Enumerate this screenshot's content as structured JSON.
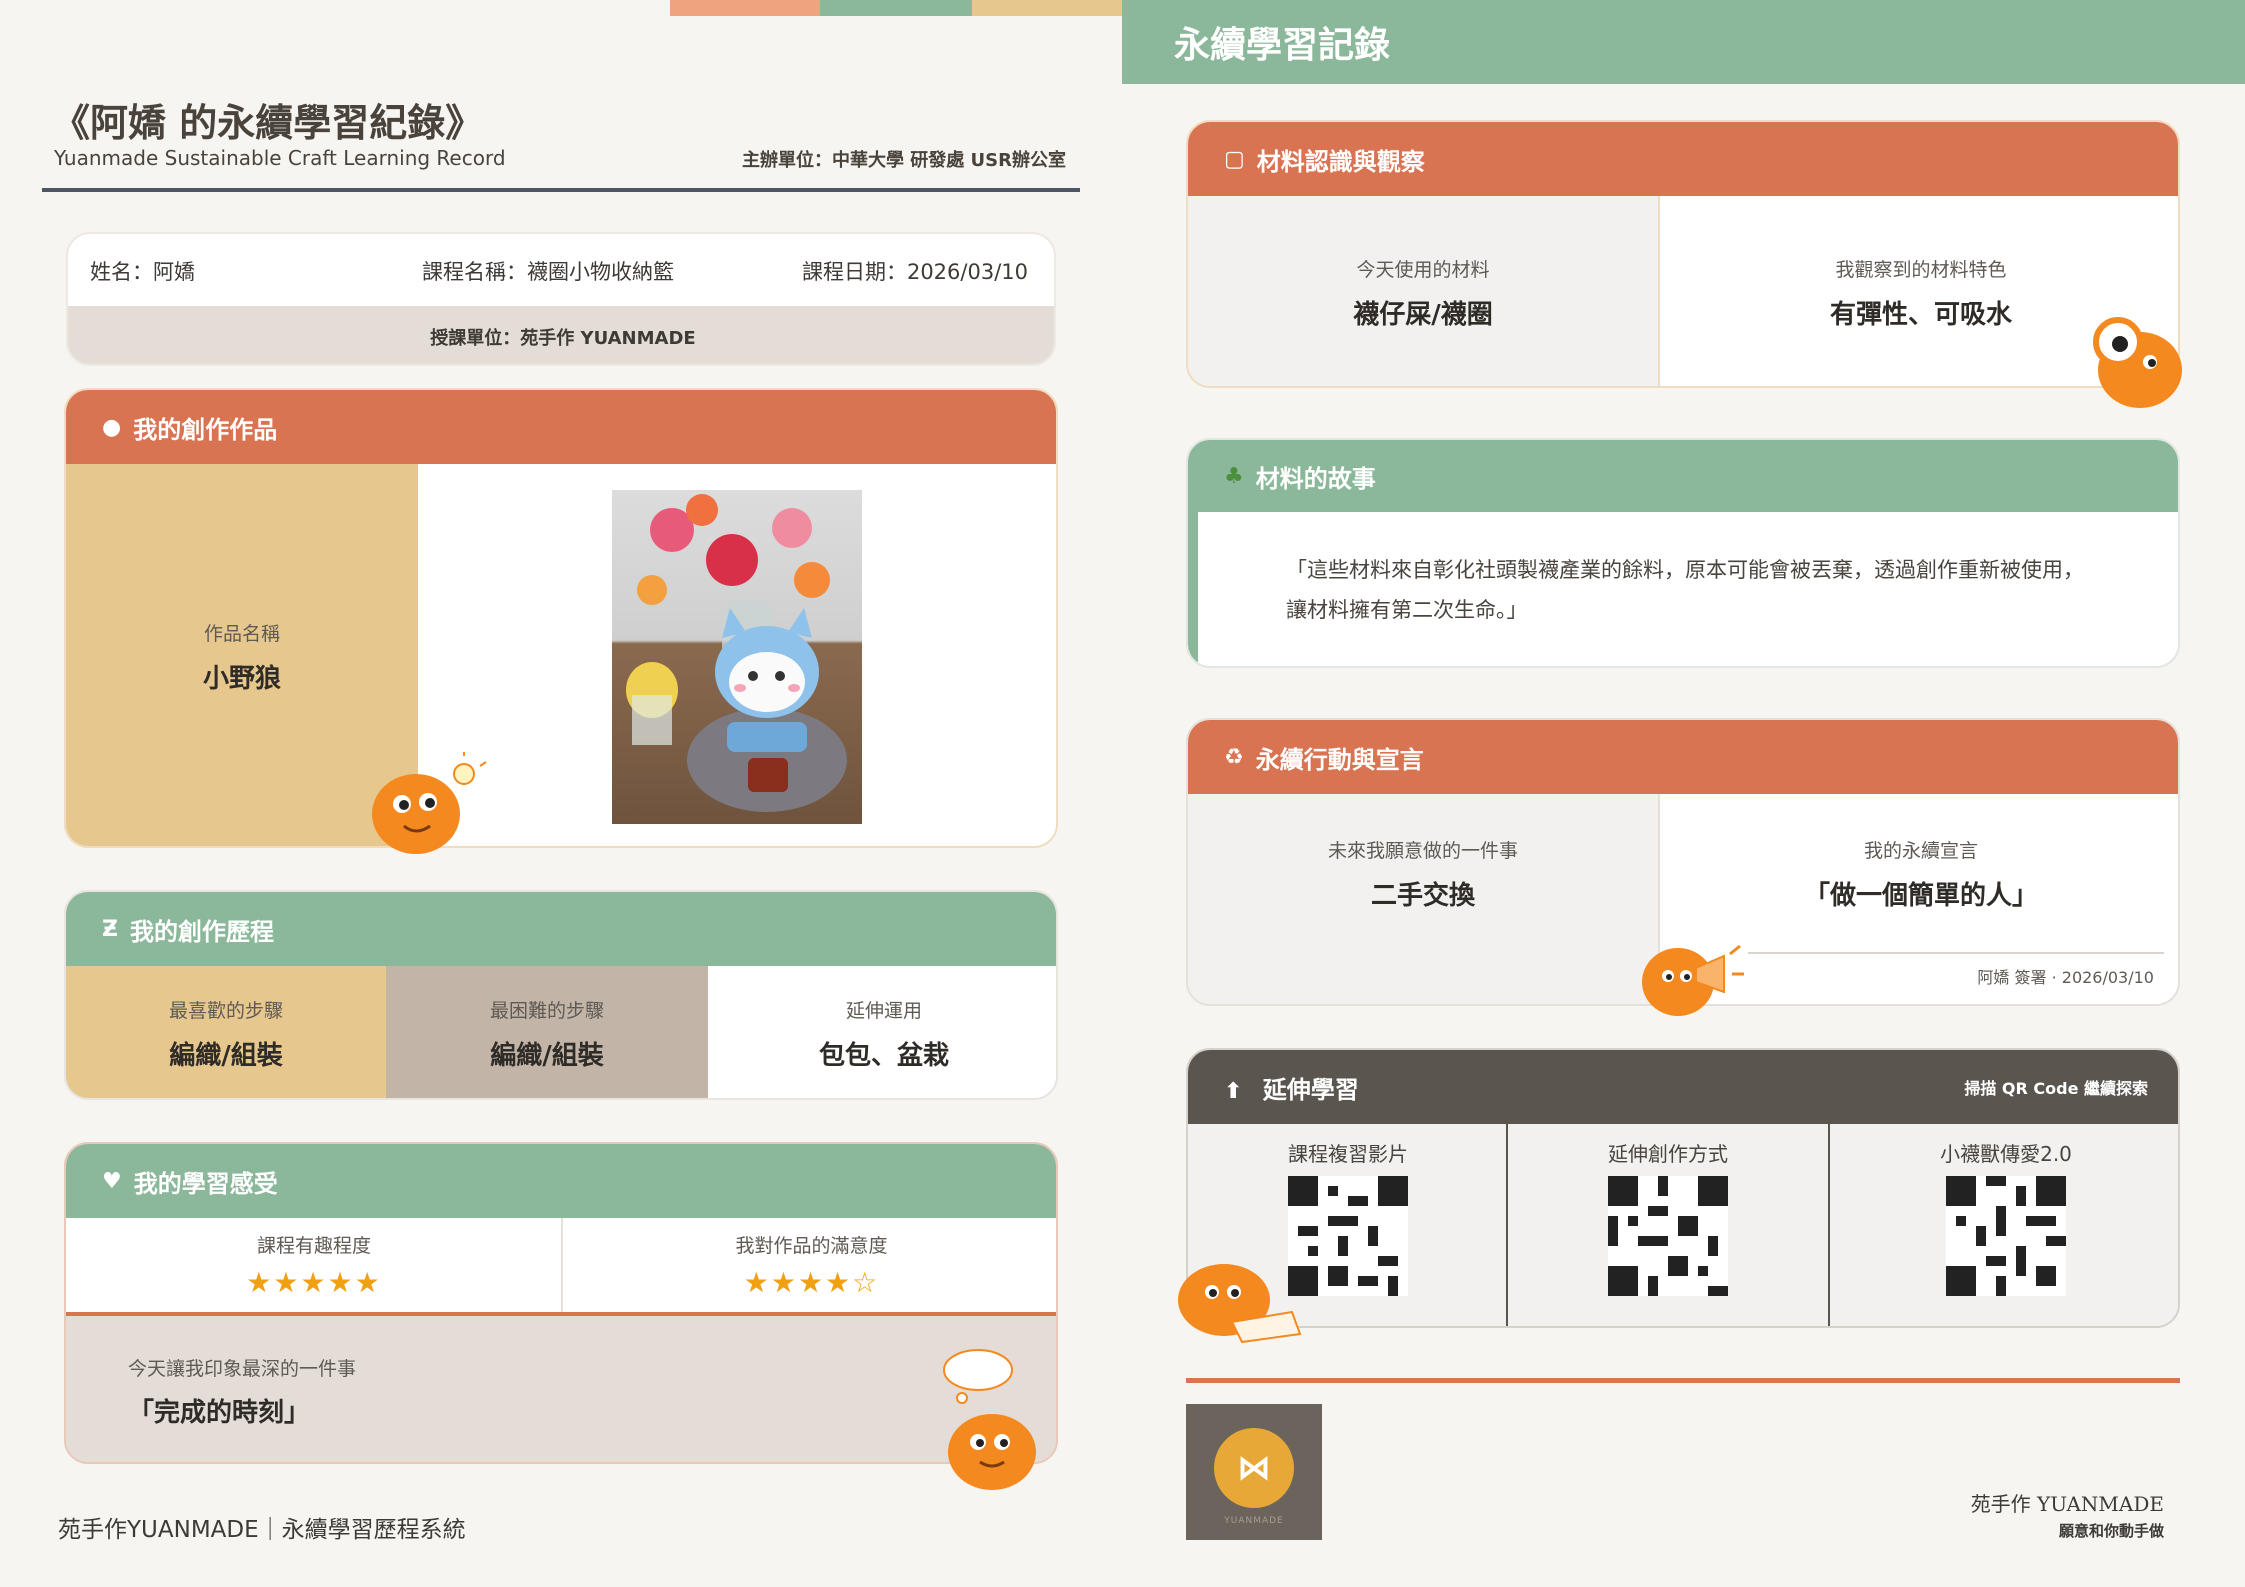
{
  "left": {
    "title": "《阿嬌 的永續學習紀錄》",
    "subtitle": "Yuanmade Sustainable Craft Learning Record",
    "organizer": "主辦單位：中華大學 研發處 USR辦公室",
    "info": {
      "name": "姓名：阿嬌",
      "course": "課程名稱：襪圈小物收納籃",
      "date": "課程日期：2026/03/10",
      "instructor": "授課單位：苑手作 YUANMADE"
    },
    "work": {
      "header": "我的創作作品",
      "name_label": "作品名稱",
      "name_value": "小野狼"
    },
    "process": {
      "header": "我的創作歷程",
      "favorite_label": "最喜歡的步驟",
      "favorite_value": "編織/組裝",
      "hardest_label": "最困難的步驟",
      "hardest_value": "編織/組裝",
      "extend_label": "延伸運用",
      "extend_value": "包包、盆栽"
    },
    "feeling": {
      "header": "我的學習感受",
      "fun_label": "課程有趣程度",
      "fun_stars": "★★★★★",
      "fun_rating": 5,
      "satisfaction_label": "我對作品的滿意度",
      "satisfaction_stars": "★★★★☆",
      "satisfaction_rating": 4,
      "impression_label": "今天讓我印象最深的一件事",
      "impression_value": "「完成的時刻」"
    },
    "footer": "苑手作YUANMADE｜永續學習歷程系統"
  },
  "right": {
    "banner_title": "永續學習記錄",
    "materials": {
      "header": "材料認識與觀察",
      "used_label": "今天使用的材料",
      "used_value": "襪仔屎/襪圈",
      "feature_label": "我觀察到的材料特色",
      "feature_value": "有彈性、可吸水"
    },
    "story": {
      "header": "材料的故事",
      "text": "「這些材料來自彰化社頭製襪產業的餘料，原本可能會被丟棄，透過創作重新被使用，讓材料擁有第二次生命。」"
    },
    "action": {
      "header": "永續行動與宣言",
      "future_label": "未來我願意做的一件事",
      "future_value": "二手交換",
      "declaration_label": "我的永續宣言",
      "declaration_value": "「做一個簡單的人」",
      "signature": "阿嬌 簽署 · 2026/03/10"
    },
    "extend": {
      "header": "延伸學習",
      "scan_hint": "掃描 QR Code 繼續探索",
      "qr": [
        {
          "label": "課程複習影片"
        },
        {
          "label": "延伸創作方式"
        },
        {
          "label": "小襪獸傳愛2.0"
        }
      ]
    },
    "brand_name": "苑手作 YUANMADE",
    "brand_slogan": "願意和你動手做",
    "logo_text": "YUANMADE"
  },
  "colors": {
    "orange": "#d97452",
    "green": "#8bb89b",
    "sand": "#e6c78d",
    "taupe": "#c2b5a8",
    "dark": "#5a554f",
    "star": "#f0a010"
  }
}
